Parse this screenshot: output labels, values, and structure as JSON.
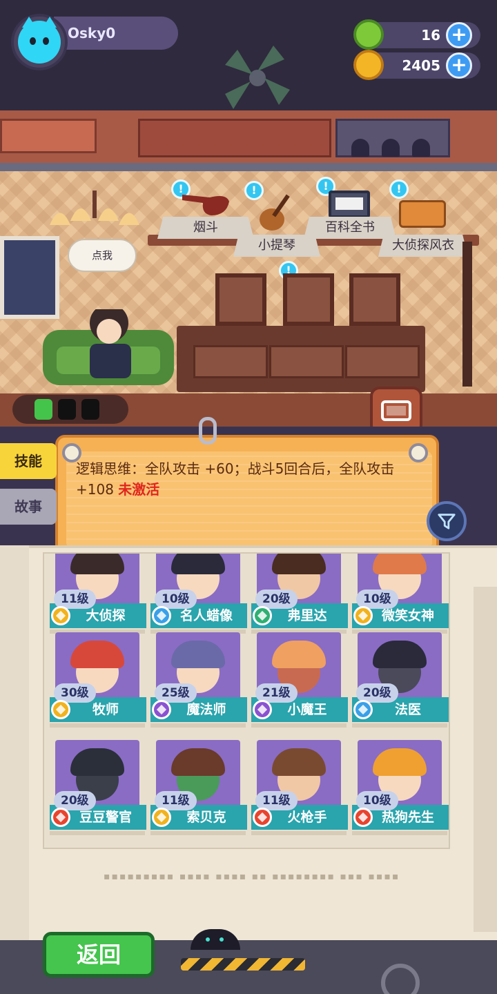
{
  "player": {
    "name": "Osky0"
  },
  "currencies": [
    {
      "icon": "donut-coin-icon",
      "value": "16",
      "color": "#7ec93a"
    },
    {
      "icon": "planet-coin-icon",
      "value": "2405",
      "color": "#f3b526"
    }
  ],
  "room": {
    "speech": "点我",
    "items": [
      {
        "label": "烟斗"
      },
      {
        "label": "小提琴"
      },
      {
        "label": "百科全书"
      },
      {
        "label": "大侦探风衣"
      }
    ]
  },
  "tabs": {
    "skill": "技能",
    "story": "故事"
  },
  "skill_panel": {
    "description": "逻辑思维：全队攻击 +60；战斗5回合后，全队攻击 +108",
    "status": "未激活"
  },
  "characters": [
    {
      "name": "大侦探",
      "level": "11级",
      "badge_color": "#f1b21e",
      "bg": "#8a6cc4",
      "hair": "#3a2a2a",
      "face": "#f7d9c0"
    },
    {
      "name": "名人蜡像",
      "level": "10级",
      "badge_color": "#3aa0e8",
      "bg": "#8a6cc4",
      "hair": "#2a2a3a",
      "face": "#f7d9c0"
    },
    {
      "name": "弗里达",
      "level": "20级",
      "badge_color": "#2fb072",
      "bg": "#8a6cc4",
      "hair": "#4a2c20",
      "face": "#f1c8a6"
    },
    {
      "name": "微笑女神",
      "level": "10级",
      "badge_color": "#f1b21e",
      "bg": "#8a6cc4",
      "hair": "#e07a4a",
      "face": "#f7d9c0"
    },
    {
      "name": "牧师",
      "level": "30级",
      "badge_color": "#f1b21e",
      "bg": "#8a6cc4",
      "hair": "#d8483a",
      "face": "#f7d9c0"
    },
    {
      "name": "魔法师",
      "level": "25级",
      "badge_color": "#8a52d0",
      "bg": "#8a6cc4",
      "hair": "#6a6aa8",
      "face": "#f7d9c0"
    },
    {
      "name": "小魔王",
      "level": "21级",
      "badge_color": "#8a52d0",
      "bg": "#8a6cc4",
      "hair": "#f0a060",
      "face": "#c86a52"
    },
    {
      "name": "法医",
      "level": "20级",
      "badge_color": "#3aa0e8",
      "bg": "#8a6cc4",
      "hair": "#2a2a3a",
      "face": "#4a4a5a"
    },
    {
      "name": "豆豆警官",
      "level": "20级",
      "badge_color": "#e8442e",
      "bg": "#8a6cc4",
      "hair": "#2a2f3a",
      "face": "#3a3f4a"
    },
    {
      "name": "索贝克",
      "level": "11级",
      "badge_color": "#f1b21e",
      "bg": "#8a6cc4",
      "hair": "#6a3a2a",
      "face": "#4a9a5a"
    },
    {
      "name": "火枪手",
      "level": "11级",
      "badge_color": "#e8442e",
      "bg": "#8a6cc4",
      "hair": "#7a4a30",
      "face": "#f1c8a6"
    },
    {
      "name": "热狗先生",
      "level": "10级",
      "badge_color": "#e8442e",
      "bg": "#8a6cc4",
      "hair": "#f0a030",
      "face": "#f7d9c0"
    }
  ],
  "buttons": {
    "back": "返回"
  }
}
